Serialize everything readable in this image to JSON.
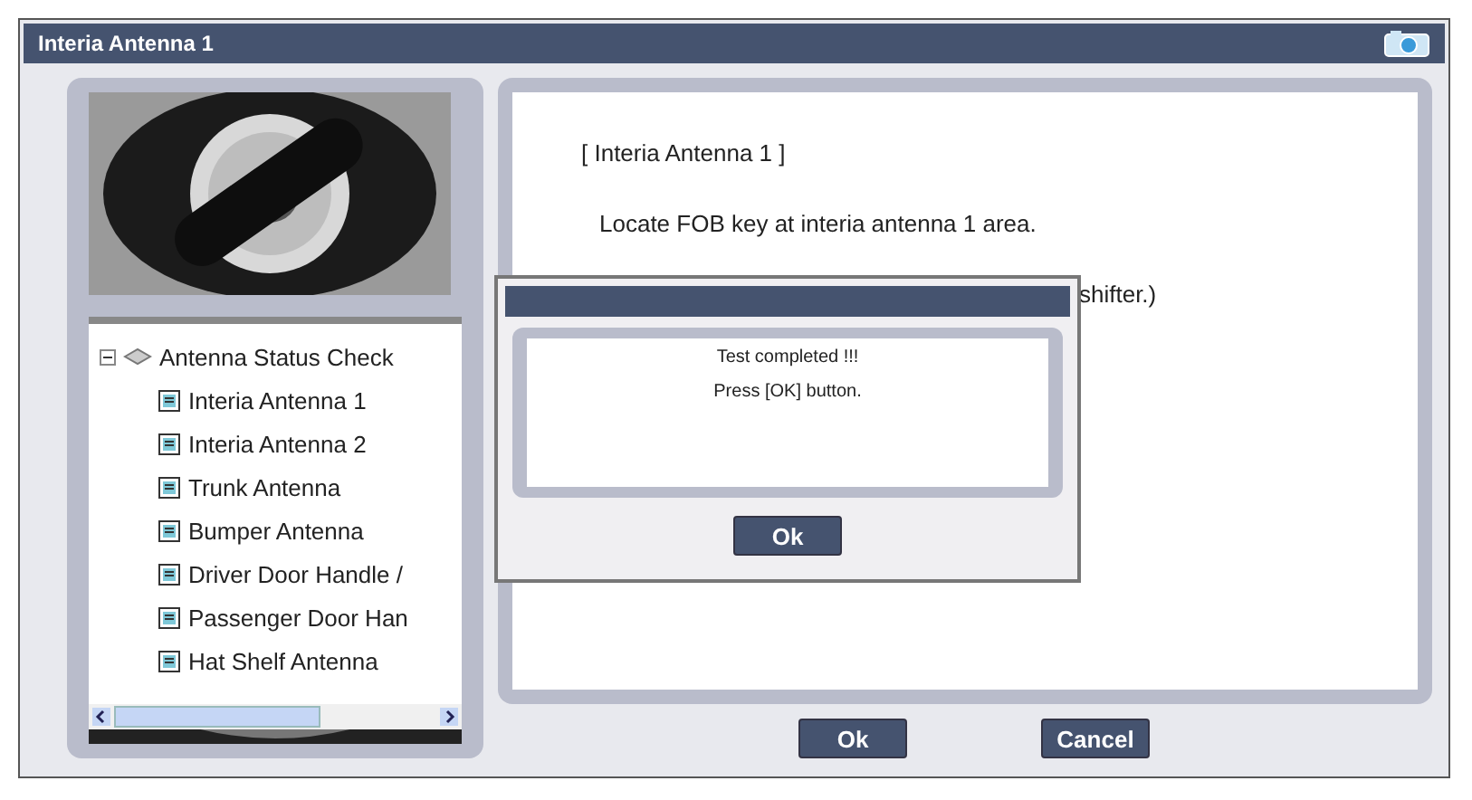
{
  "window": {
    "title": "Interia Antenna 1"
  },
  "tree": {
    "root": {
      "label": "Antenna Status Check",
      "expanded": true,
      "children": [
        {
          "label": "Interia Antenna 1"
        },
        {
          "label": "Interia Antenna 2"
        },
        {
          "label": "Trunk Antenna"
        },
        {
          "label": "Bumper Antenna"
        },
        {
          "label": "Driver Door Handle /"
        },
        {
          "label": "Passenger Door Han"
        },
        {
          "label": "Hat Shelf Antenna"
        }
      ]
    }
  },
  "content": {
    "heading": "[ Interia Antenna 1 ]",
    "lines": [
      "Locate FOB key at interia antenna 1 area.",
      "shifter.)"
    ]
  },
  "buttons": [
    "Ok",
    "Cancel"
  ],
  "dialog": {
    "lines": [
      "Test completed !!!",
      "Press [OK] button."
    ],
    "button": "Ok"
  }
}
